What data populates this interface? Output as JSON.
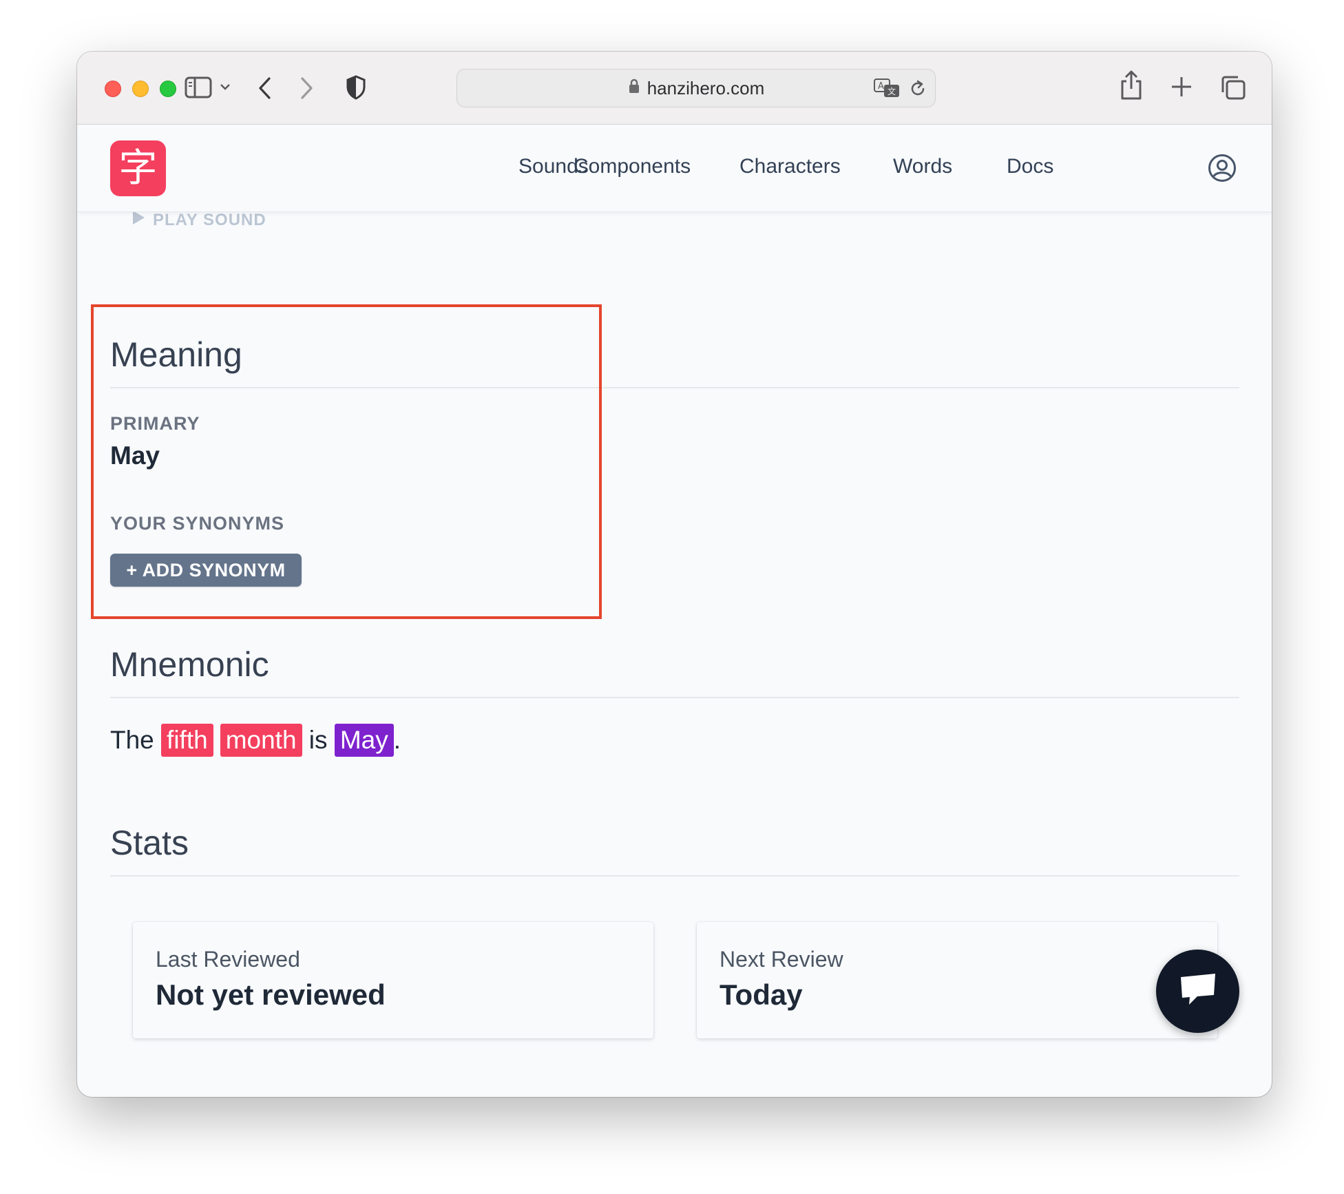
{
  "browser": {
    "url": "hanzihero.com",
    "icons": [
      "sidebar-icon",
      "chevron-down-icon",
      "back-icon",
      "forward-icon",
      "shield-icon",
      "lock-icon",
      "translate-icon",
      "reload-icon",
      "share-icon",
      "plus-icon",
      "tabs-icon"
    ]
  },
  "header": {
    "logo_char": "字",
    "nav": [
      "Sounds",
      "Components",
      "Characters",
      "Words",
      "Docs"
    ],
    "account_icon": "user-circle-icon"
  },
  "content": {
    "play_sound_label": "PLAY SOUND",
    "meaning": {
      "title": "Meaning",
      "primary_label": "PRIMARY",
      "primary_value": "May",
      "synonyms_label": "YOUR SYNONYMS",
      "add_synonym_label": "+ ADD SYNONYM"
    },
    "mnemonic": {
      "title": "Mnemonic",
      "parts": {
        "the": "The ",
        "fifth": "fifth",
        "month": "month",
        "is": " is ",
        "may": "May",
        "period": "."
      }
    },
    "stats": {
      "title": "Stats",
      "last_reviewed_label": "Last Reviewed",
      "last_reviewed_value": "Not yet reviewed",
      "next_review_label": "Next Review",
      "next_review_value": "Today"
    }
  },
  "colors": {
    "brand": "#f43f5e",
    "component_tag": "#f43f5e",
    "meaning_tag": "#7e22ce",
    "highlight_box": "#e5452d"
  }
}
